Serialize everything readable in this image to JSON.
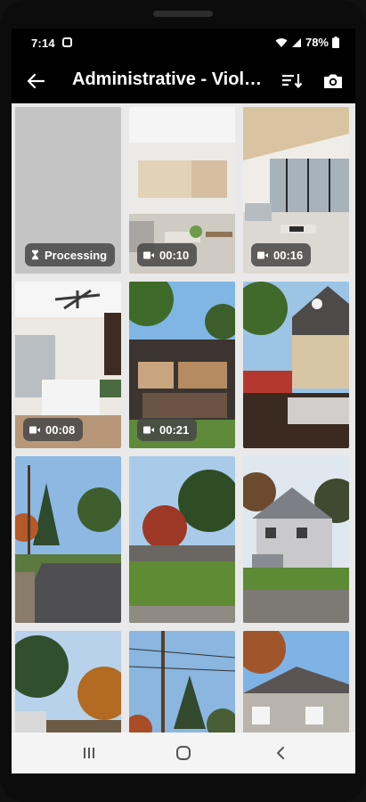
{
  "status_bar": {
    "time": "7:14",
    "battery_percent": "78%",
    "icons": [
      "notification-icon",
      "wifi-icon",
      "signal-icon",
      "battery-icon"
    ]
  },
  "app_bar": {
    "title": "Administrative - Violation",
    "back_icon": "arrow-left-icon",
    "sort_icon": "sort-descending-icon",
    "camera_icon": "camera-icon"
  },
  "gallery": {
    "tiles": [
      {
        "type": "placeholder",
        "badge": "Processing",
        "badge_icon": "hourglass-icon"
      },
      {
        "type": "video",
        "badge": "00:10",
        "badge_icon": "video-icon"
      },
      {
        "type": "video",
        "badge": "00:16",
        "badge_icon": "video-icon"
      },
      {
        "type": "video",
        "badge": "00:08",
        "badge_icon": "video-icon"
      },
      {
        "type": "video",
        "badge": "00:21",
        "badge_icon": "video-icon"
      },
      {
        "type": "photo",
        "badge": ""
      },
      {
        "type": "photo",
        "badge": ""
      },
      {
        "type": "photo",
        "badge": ""
      },
      {
        "type": "photo",
        "badge": ""
      },
      {
        "type": "photo",
        "badge": ""
      },
      {
        "type": "photo",
        "badge": ""
      },
      {
        "type": "photo",
        "badge": ""
      }
    ]
  },
  "nav_bar": {
    "recents_icon": "recents-icon",
    "home_icon": "home-icon",
    "back_icon": "nav-back-icon"
  },
  "colors": {
    "phone_frame": "#0c0c0c",
    "screen_bg": "#000000",
    "grid_bg": "#e9e9e9",
    "placeholder_tile": "#c4c4c4",
    "badge_bg": "#464646",
    "nav_bar_bg": "#f4f4f4"
  }
}
